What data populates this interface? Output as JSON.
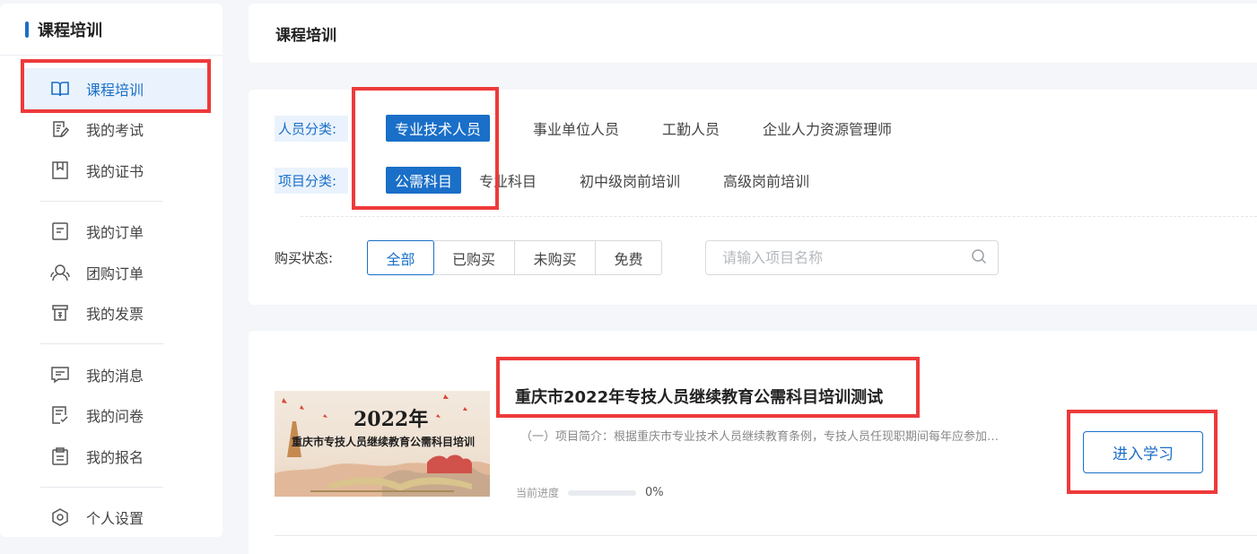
{
  "sidebar": {
    "title": "课程培训",
    "items": [
      {
        "label": "课程培训",
        "icon": "book-icon"
      },
      {
        "label": "我的考试",
        "icon": "edit-doc-icon"
      },
      {
        "label": "我的证书",
        "icon": "bookmark-icon"
      },
      {
        "label": "我的订单",
        "icon": "order-icon"
      },
      {
        "label": "团购订单",
        "icon": "group-icon"
      },
      {
        "label": "我的发票",
        "icon": "invoice-icon"
      },
      {
        "label": "我的消息",
        "icon": "message-icon"
      },
      {
        "label": "我的问卷",
        "icon": "survey-icon"
      },
      {
        "label": "我的报名",
        "icon": "clipboard-icon"
      },
      {
        "label": "个人设置",
        "icon": "settings-icon"
      }
    ]
  },
  "header": {
    "title": "课程培训"
  },
  "filters": {
    "person": {
      "label": "人员分类:",
      "options": [
        "专业技术人员",
        "事业单位人员",
        "工勤人员",
        "企业人力资源管理师"
      ],
      "selected": "专业技术人员"
    },
    "project": {
      "label": "项目分类:",
      "options": [
        "公需科目",
        "专业科目",
        "初中级岗前培训",
        "高级岗前培训"
      ],
      "selected": "公需科目"
    },
    "purchase": {
      "label": "购买状态:",
      "options": [
        "全部",
        "已购买",
        "未购买",
        "免费"
      ],
      "selected": "全部"
    },
    "search_placeholder": "请输入项目名称"
  },
  "course": {
    "thumb_year": "2022年",
    "thumb_title": "重庆市专技人员继续教育公需科目培训",
    "title": "重庆市2022年专技人员继续教育公需科目培训测试",
    "desc": "（一）项目简介：根据重庆市专业技术人员继续教育条例，专技人员任现职期间每年应参加继续教育",
    "progress_label": "当前进度",
    "progress_value": 0,
    "progress_text": "0%",
    "enter_label": "进入学习"
  },
  "colors": {
    "accent": "#1a6fc8",
    "highlight": "#ee3a3a"
  }
}
